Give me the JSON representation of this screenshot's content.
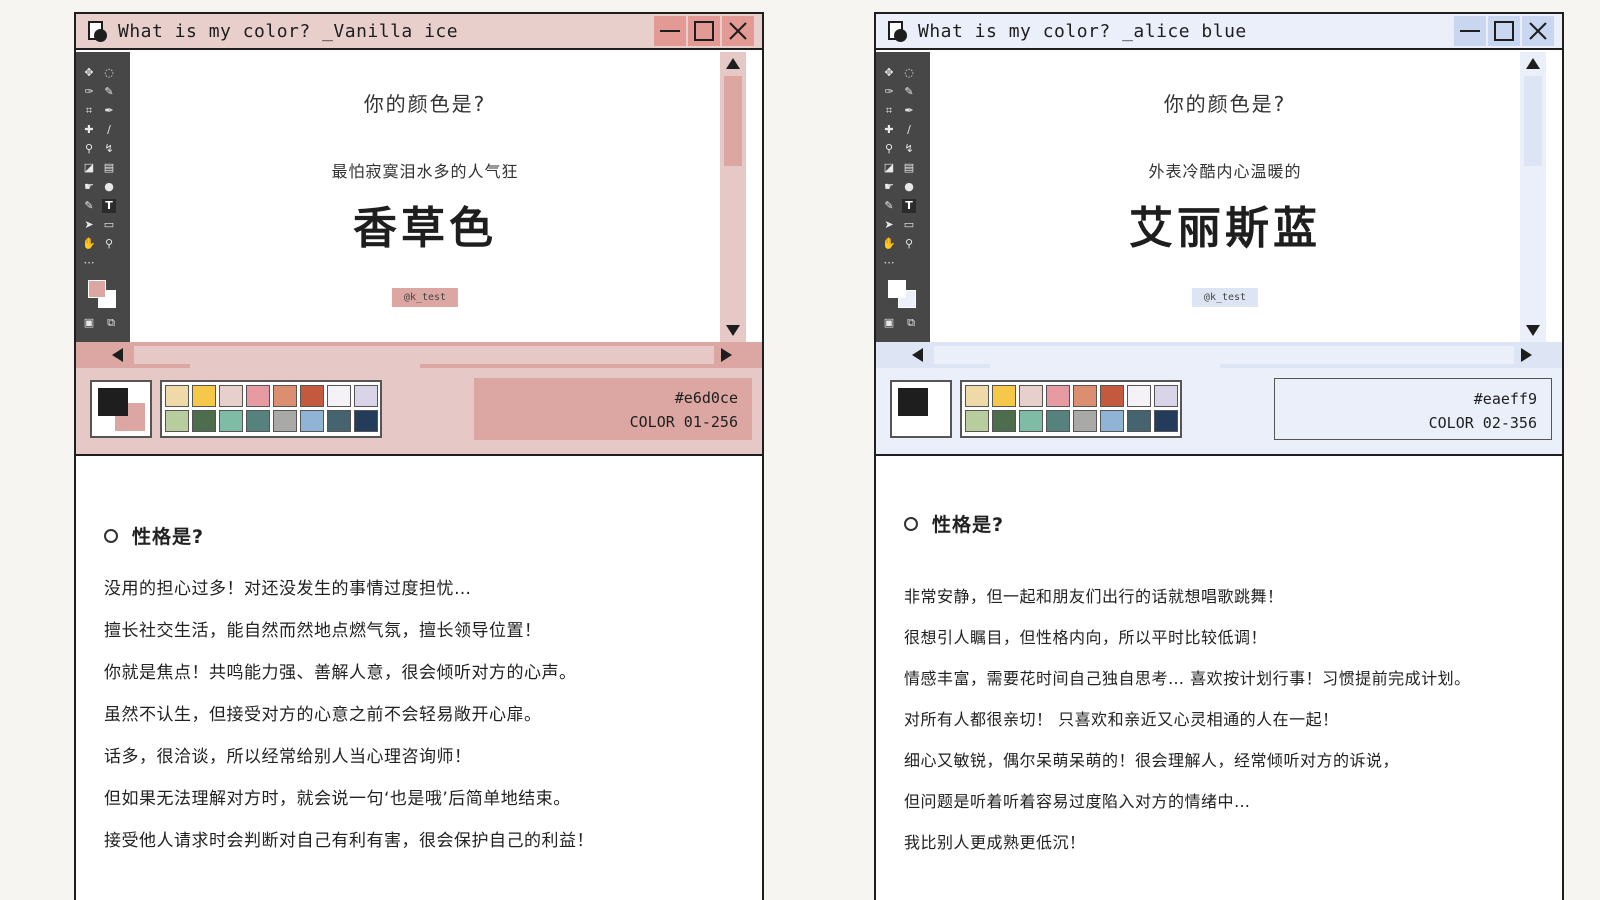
{
  "panels": [
    {
      "window_title": "What is my color? _Vanilla ice",
      "question": "你的颜色是?",
      "subtitle": "最怕寂寞泪水多的人气狂",
      "color_name": "香草色",
      "handle": "@k_test",
      "hex": "#e6d0ce",
      "color_code": "COLOR 01-256",
      "section_title": "性格是?",
      "lines": [
        "没用的担心过多！对还没发生的事情过度担忧…",
        "擅长社交生活，能自然而然地点燃气氛，擅长领导位置！",
        "你就是焦点！共鸣能力强、善解人意，很会倾听对方的心声。",
        "虽然不认生，但接受对方的心意之前不会轻易敞开心扉。",
        "话多，很洽谈，所以经常给别人当心理咨询师！",
        "但如果无法理解对方时，就会说一句‘也是哦’后简单地结束。",
        "接受他人请求时会判断对自己有利有害，很会保护自己的利益！"
      ],
      "colors": {
        "theme": "#e6c9c6",
        "theme_dark": "#dca6a2",
        "titlebar": "#e8cfcc",
        "winbtn": "#e49a94",
        "fg_swatch": "#dca6a2",
        "bg_swatch": "#ffffff"
      }
    },
    {
      "window_title": "What is my color? _alice blue",
      "question": "你的颜色是?",
      "subtitle": "外表冷酷内心温暖的",
      "color_name": "艾丽斯蓝",
      "handle": "@k_test",
      "hex": "#eaeff9",
      "color_code": "COLOR 02-356",
      "section_title": "性格是?",
      "lines": [
        "非常安静，但一起和朋友们出行的话就想唱歌跳舞！",
        "很想引人瞩目，但性格内向，所以平时比较低调！",
        "情感丰富，需要花时间自己独自思考… 喜欢按计划行事！习惯提前完成计划。",
        "对所有人都很亲切！ 只喜欢和亲近又心灵相通的人在一起！",
        "细心又敏锐，偶尔呆萌呆萌的！很会理解人，经常倾听对方的诉说，",
        "但问题是听着听着容易过度陷入对方的情绪中…",
        "我比别人更成熟更低沉！"
      ],
      "colors": {
        "theme": "#eaeff9",
        "theme_dark": "#dde5f4",
        "titlebar": "#eaeff9",
        "winbtn": "#c9d6f0",
        "fg_swatch": "#ffffff",
        "bg_swatch": "#eaeff9"
      }
    }
  ],
  "palette": [
    "#f0d9a8",
    "#f5c84a",
    "#e7cfcb",
    "#e79aa2",
    "#dc8f70",
    "#c45a3d",
    "#f4f2f6",
    "#d9d4e8",
    "#b9cc9e",
    "#4d6e4c",
    "#7fbca5",
    "#56827d",
    "#a9aaa6",
    "#8fb4d6",
    "#466470",
    "#233c5c"
  ],
  "toolbar_icons": [
    "move-icon",
    "lasso-icon",
    "quick-select-icon",
    "magic-wand-icon",
    "crop-icon",
    "eyedropper-icon",
    "healing-icon",
    "brush-icon",
    "stamp-icon",
    "history-brush-icon",
    "eraser-icon",
    "gradient-icon",
    "smudge-icon",
    "dodge-icon",
    "pen-icon",
    "text-icon",
    "path-select-icon",
    "rectangle-icon",
    "hand-icon",
    "zoom-icon",
    "more-icon"
  ],
  "toolbar_glyphs": [
    "✥",
    "◌",
    "✑",
    "✎",
    "⌗",
    "✒",
    "✚",
    "∕",
    "⚲",
    "↯",
    "◪",
    "▤",
    "☛",
    "●",
    "✎",
    "T",
    "➤",
    "▭",
    "✋",
    "⚲",
    "⋯"
  ],
  "win_buttons": {
    "minimize": "—",
    "maximize": "☐",
    "close": "X"
  }
}
